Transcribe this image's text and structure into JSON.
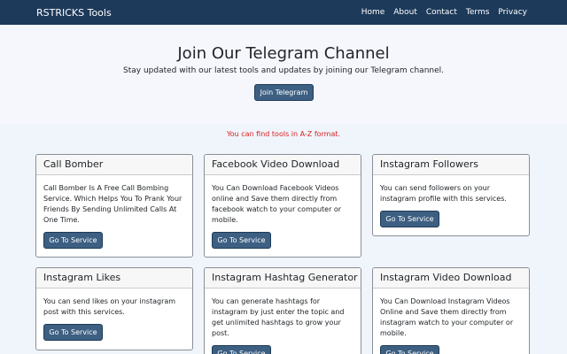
{
  "nav": {
    "brand": "RSTRICKS Tools",
    "links": [
      "Home",
      "About",
      "Contact",
      "Terms",
      "Privacy"
    ]
  },
  "hero": {
    "title": "Join Our Telegram Channel",
    "subtitle": "Stay updated with our latest tools and updates by joining our Telegram channel.",
    "button": "Join Telegram"
  },
  "notice": "You can find tools in A-Z format.",
  "cards": [
    {
      "title": "Call Bomber",
      "text": "Call Bomber Is A Free Call Bombing Service. Which Helps You To Prank Your Friends By Sending Unlimited Calls At One Time.",
      "button": "Go To Service"
    },
    {
      "title": "Facebook Video Download",
      "text": "You Can Download Facebook Videos online and Save them directly from facebook watch to your computer or mobile.",
      "button": "Go To Service"
    },
    {
      "title": "Instagram Followers",
      "text": "You can send followers on your instagram profile with this services.",
      "button": "Go To Service"
    },
    {
      "title": "Instagram Likes",
      "text": "You can send likes on your instagram post with this services.",
      "button": "Go To Service"
    },
    {
      "title": "Instagram Hashtag Generator",
      "text": "You can generate hashtags for instagram by just enter the topic and get unlimited hashtags to grow your post.",
      "button": "Go To Service"
    },
    {
      "title": "Instagram Video Download",
      "text": "You Can Download Instagram Videos Online and Save them directly from instagram watch to your computer or mobile.",
      "button": "Go To Service"
    }
  ]
}
